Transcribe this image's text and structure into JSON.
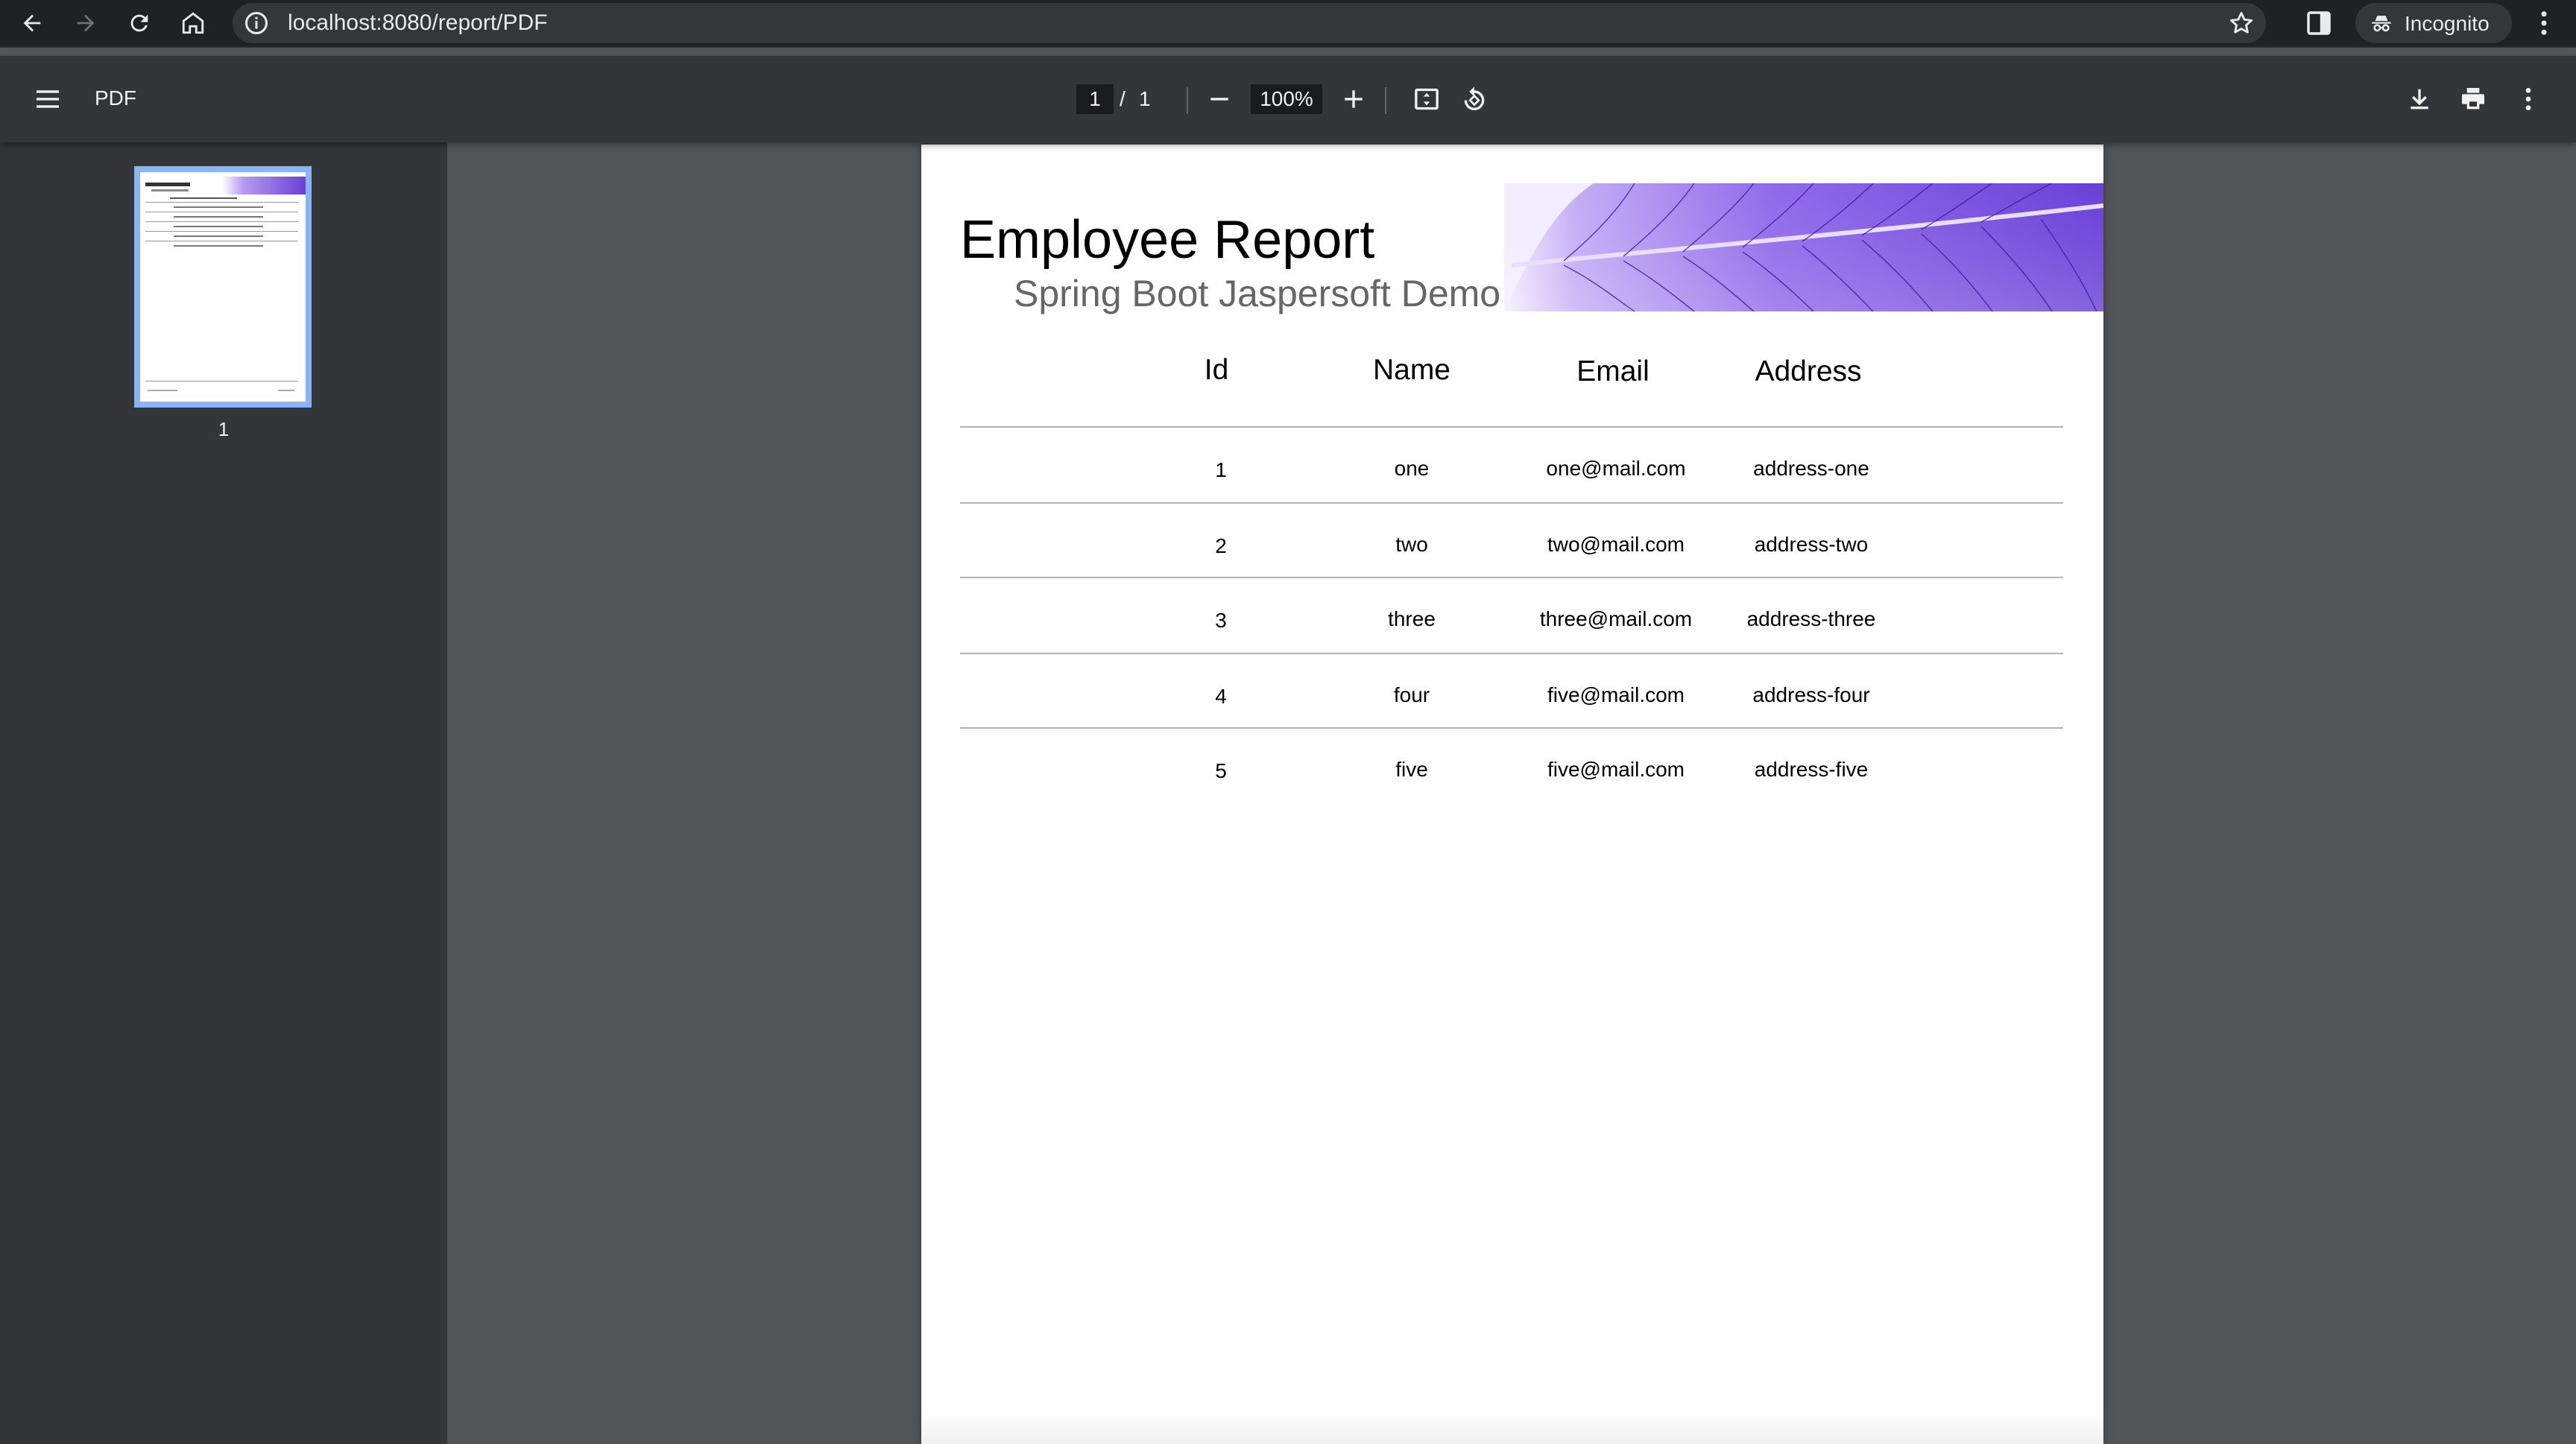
{
  "browser": {
    "url": "localhost:8080/report/PDF",
    "profile_label": "Incognito"
  },
  "viewer": {
    "title": "PDF",
    "current_page": "1",
    "page_separator": "/",
    "total_pages": "1",
    "zoom": "100%",
    "thumbnail_label": "1"
  },
  "report": {
    "title": "Employee Report",
    "subtitle": "Spring Boot Jaspersoft Demo",
    "columns": [
      "Id",
      "Name",
      "Email",
      "Address"
    ],
    "rows": [
      {
        "id": "1",
        "name": "one",
        "email": "one@mail.com",
        "address": "address-one"
      },
      {
        "id": "2",
        "name": "two",
        "email": "two@mail.com",
        "address": "address-two"
      },
      {
        "id": "3",
        "name": "three",
        "email": "three@mail.com",
        "address": "address-three"
      },
      {
        "id": "4",
        "name": "four",
        "email": "five@mail.com",
        "address": "address-four"
      },
      {
        "id": "5",
        "name": "five",
        "email": "five@mail.com",
        "address": "address-five"
      }
    ]
  },
  "colors": {
    "browser_bar": "#202124",
    "viewer_toolbar": "#323639",
    "viewer_background": "#525659",
    "thumbnail_selected": "#8ab4f8",
    "leaf_purple": "#7b4fe0"
  }
}
